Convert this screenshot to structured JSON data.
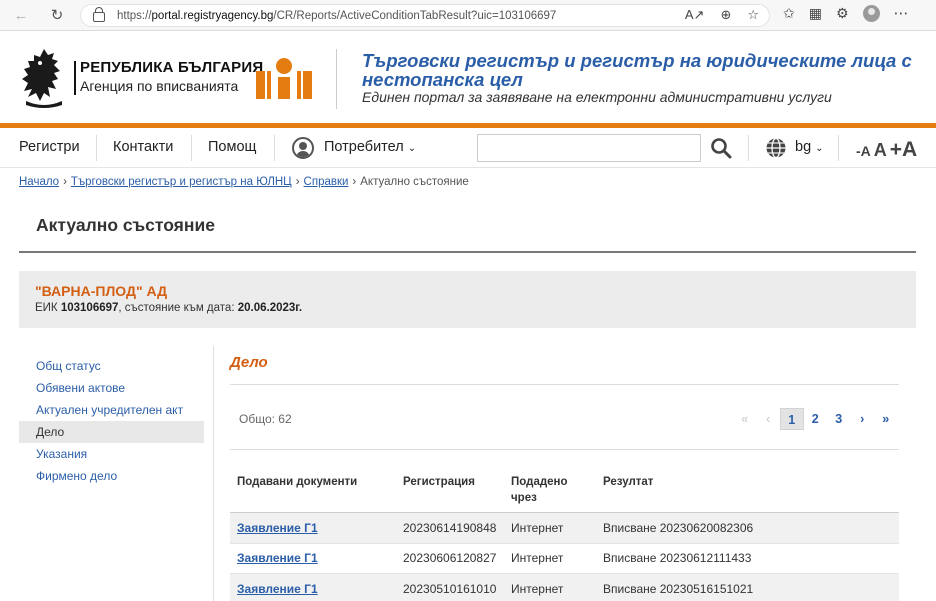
{
  "browser": {
    "url_prefix": "https://",
    "url_host": "portal.registryagency.bg",
    "url_path": "/CR/Reports/ActiveConditionTabResult?uic=103106697"
  },
  "header": {
    "republic": "РЕПУБЛИКА БЪЛГАРИЯ",
    "agency": "Агенция по вписванията",
    "portal_title": "Търговски регистър и регистър на юридическите лица с нестопанска цел",
    "portal_subtitle": "Единен портал за заявяване на електронни административни услуги",
    "brand_color": "#2b5ea8",
    "accent_color": "#e57c12"
  },
  "nav": {
    "registers": "Регистри",
    "contacts": "Контакти",
    "help": "Помощ",
    "user": "Потребител",
    "search_placeholder": "",
    "lang": "bg",
    "font_decrease": "-A",
    "font_normal": "A",
    "font_increase": "+A"
  },
  "breadcrumb": {
    "items": [
      "Начало",
      "Търговски регистър и регистър на ЮЛНЦ",
      "Справки"
    ],
    "current": "Актуално състояние",
    "separator": "›"
  },
  "page": {
    "title": "Актуално състояние"
  },
  "company": {
    "name": "\"ВАРНА-ПЛОД\" АД",
    "eik_label": "ЕИК",
    "eik": "103106697",
    "state_label": ", състояние към дата:",
    "date": "20.06.2023г."
  },
  "sidebar": {
    "items": [
      {
        "label": "Общ статус"
      },
      {
        "label": "Обявени актове"
      },
      {
        "label": "Актуален учредителен акт"
      },
      {
        "label": "Дело"
      },
      {
        "label": "Указания"
      },
      {
        "label": "Фирмено дело"
      }
    ],
    "active_index": 3
  },
  "content": {
    "section_title": "Дело",
    "total": "Общо: 62",
    "pager": {
      "first": "«",
      "prev": "‹",
      "pages": [
        "1",
        "2",
        "3"
      ],
      "current": "1",
      "next": "›",
      "last": "»"
    },
    "columns": [
      "Подавани документи",
      "Регистрация",
      "Подадено\nчрез",
      "Резултат"
    ],
    "column_lines": {
      "submitted_line1": "Подадено",
      "submitted_line2": "чрез"
    },
    "rows": [
      {
        "document": "Заявление Г1",
        "registration": "20230614190848",
        "via": "Интернет",
        "result": "Вписване 20230620082306"
      },
      {
        "document": "Заявление Г1",
        "registration": "20230606120827",
        "via": "Интернет",
        "result": "Вписване 20230612111433"
      },
      {
        "document": "Заявление Г1",
        "registration": "20230510161010",
        "via": "Интернет",
        "result": "Вписване 20230516151021"
      }
    ]
  }
}
